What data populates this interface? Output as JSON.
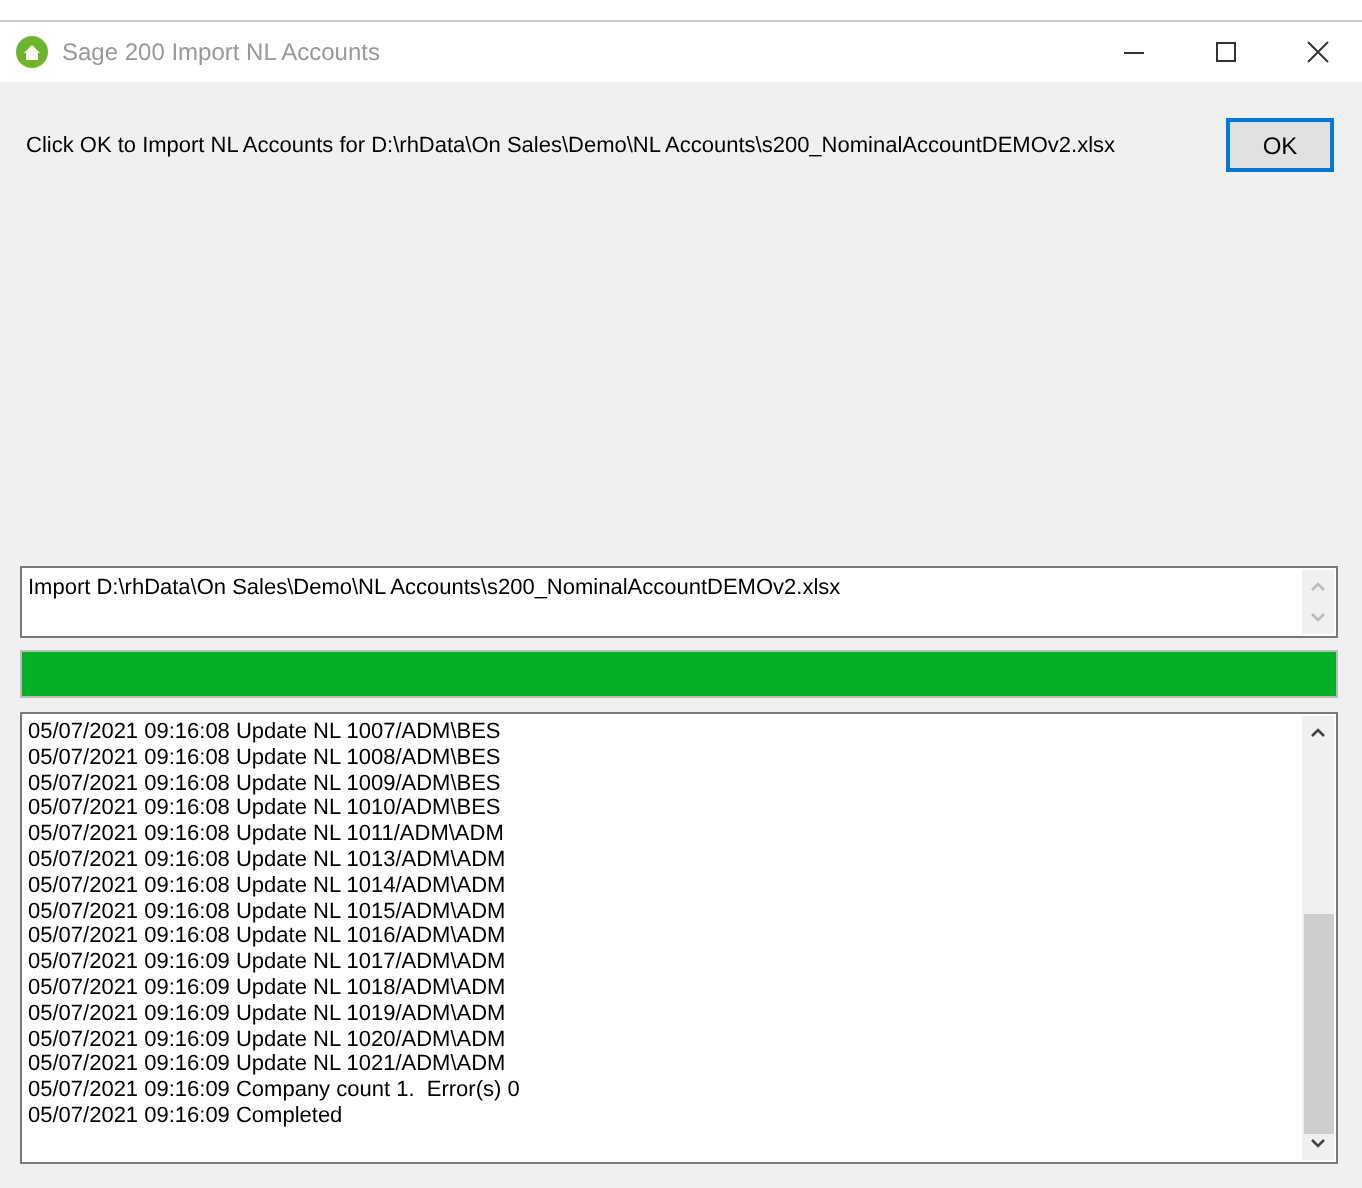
{
  "window": {
    "title": "Sage 200 Import NL Accounts"
  },
  "message": "Click OK to Import NL Accounts for D:\\rhData\\On Sales\\Demo\\NL Accounts\\s200_NominalAccountDEMOv2.xlsx",
  "ok_button": "OK",
  "import_field": {
    "value": "Import D:\\rhData\\On Sales\\Demo\\NL Accounts\\s200_NominalAccountDEMOv2.xlsx"
  },
  "progress": {
    "level": 1
  },
  "log": [
    "05/07/2021 09:16:08 Update NL 1007/ADM\\BES",
    "05/07/2021 09:16:08 Update NL 1008/ADM\\BES",
    "05/07/2021 09:16:08 Update NL 1009/ADM\\BES",
    "05/07/2021 09:16:08 Update NL 1010/ADM\\BES",
    "05/07/2021 09:16:08 Update NL 1011/ADM\\ADM",
    "05/07/2021 09:16:08 Update NL 1013/ADM\\ADM",
    "05/07/2021 09:16:08 Update NL 1014/ADM\\ADM",
    "05/07/2021 09:16:08 Update NL 1015/ADM\\ADM",
    "05/07/2021 09:16:08 Update NL 1016/ADM\\ADM",
    "05/07/2021 09:16:09 Update NL 1017/ADM\\ADM",
    "05/07/2021 09:16:09 Update NL 1018/ADM\\ADM",
    "05/07/2021 09:16:09 Update NL 1019/ADM\\ADM",
    "05/07/2021 09:16:09 Update NL 1020/ADM\\ADM",
    "05/07/2021 09:16:09 Update NL 1021/ADM\\ADM",
    "05/07/2021 09:16:09 Company count 1.  Error(s) 0",
    "05/07/2021 09:16:09 Completed"
  ]
}
